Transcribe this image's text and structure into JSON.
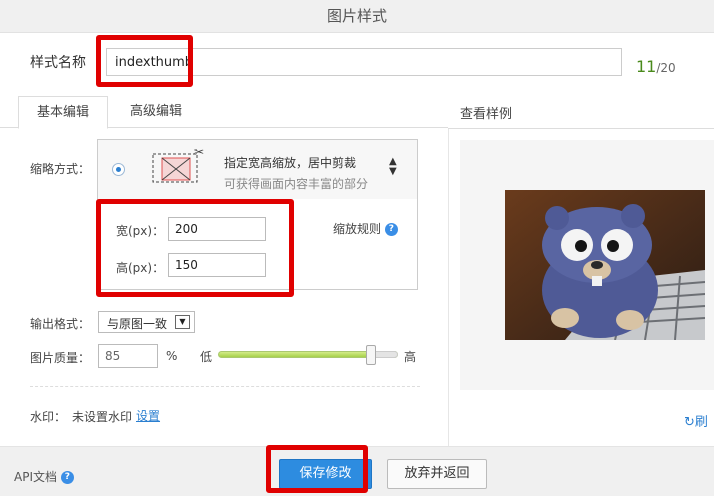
{
  "dialog": {
    "title": "图片样式"
  },
  "style_name": {
    "label": "样式名称",
    "value": "indexthumb",
    "count": "11",
    "max": "/20"
  },
  "tabs": [
    {
      "label": "基本编辑",
      "active": true
    },
    {
      "label": "高级编辑",
      "active": false
    }
  ],
  "thumbnail": {
    "label": "缩略方式：",
    "mode_title": "指定宽高缩放，居中剪裁",
    "mode_desc": "可获得画面内容丰富的部分",
    "width_label": "宽(px)：",
    "width_value": "200",
    "height_label": "高(px)：",
    "height_value": "150",
    "rule_label": "缩放规则"
  },
  "output": {
    "label": "输出格式：",
    "selected": "与原图一致"
  },
  "quality": {
    "label": "图片质量：",
    "value": "85",
    "unit": "%",
    "low": "低",
    "high": "高",
    "level_percent": 85
  },
  "watermark": {
    "label": "水印：",
    "status": "未设置水印",
    "link": "设置"
  },
  "preview": {
    "header": "查看样例",
    "refresh_label": "刷"
  },
  "footer": {
    "api_doc": "API文档",
    "save": "保存修改",
    "cancel": "放弃并返回"
  },
  "colors": {
    "accent": "#2d8ce0",
    "highlight": "#e00000",
    "count": "#4a8a1c"
  },
  "icons": [
    "crop-scale-icon",
    "scissors-icon",
    "sort-arrows-icon",
    "help-icon",
    "refresh-icon",
    "dropdown-arrow-icon"
  ]
}
